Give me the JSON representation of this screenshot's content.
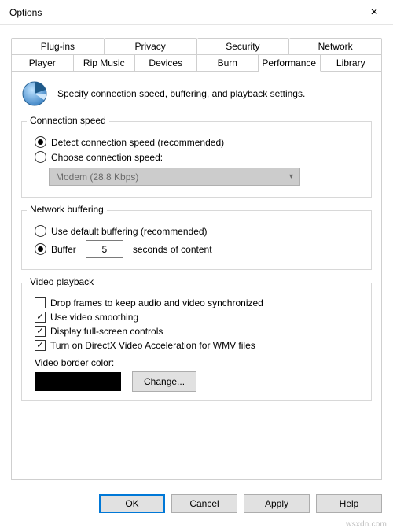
{
  "window": {
    "title": "Options",
    "close_icon": "×"
  },
  "tabs_top": [
    "Plug-ins",
    "Privacy",
    "Security",
    "Network"
  ],
  "tabs_bottom": [
    "Player",
    "Rip Music",
    "Devices",
    "Burn",
    "Performance",
    "Library"
  ],
  "active_tab": "Performance",
  "intro_text": "Specify connection speed, buffering, and playback settings.",
  "connection_speed": {
    "legend": "Connection speed",
    "detect_label": "Detect connection speed (recommended)",
    "choose_label": "Choose connection speed:",
    "selected": "detect",
    "dropdown_value": "Modem (28.8 Kbps)"
  },
  "buffering": {
    "legend": "Network buffering",
    "default_label": "Use default buffering (recommended)",
    "buffer_label": "Buffer",
    "buffer_value": "5",
    "buffer_suffix": "seconds of content",
    "selected": "buffer"
  },
  "video": {
    "legend": "Video playback",
    "drop_frames": {
      "label": "Drop frames to keep audio and video synchronized",
      "checked": false
    },
    "smoothing": {
      "label": "Use video smoothing",
      "checked": true
    },
    "fullscreen": {
      "label": "Display full-screen controls",
      "checked": true
    },
    "directx": {
      "label": "Turn on DirectX Video Acceleration for WMV files",
      "checked": true
    },
    "border_label": "Video border color:",
    "border_color": "#000000",
    "change_label": "Change..."
  },
  "buttons": {
    "ok": "OK",
    "cancel": "Cancel",
    "apply": "Apply",
    "help": "Help"
  },
  "watermark": "wsxdn.com"
}
